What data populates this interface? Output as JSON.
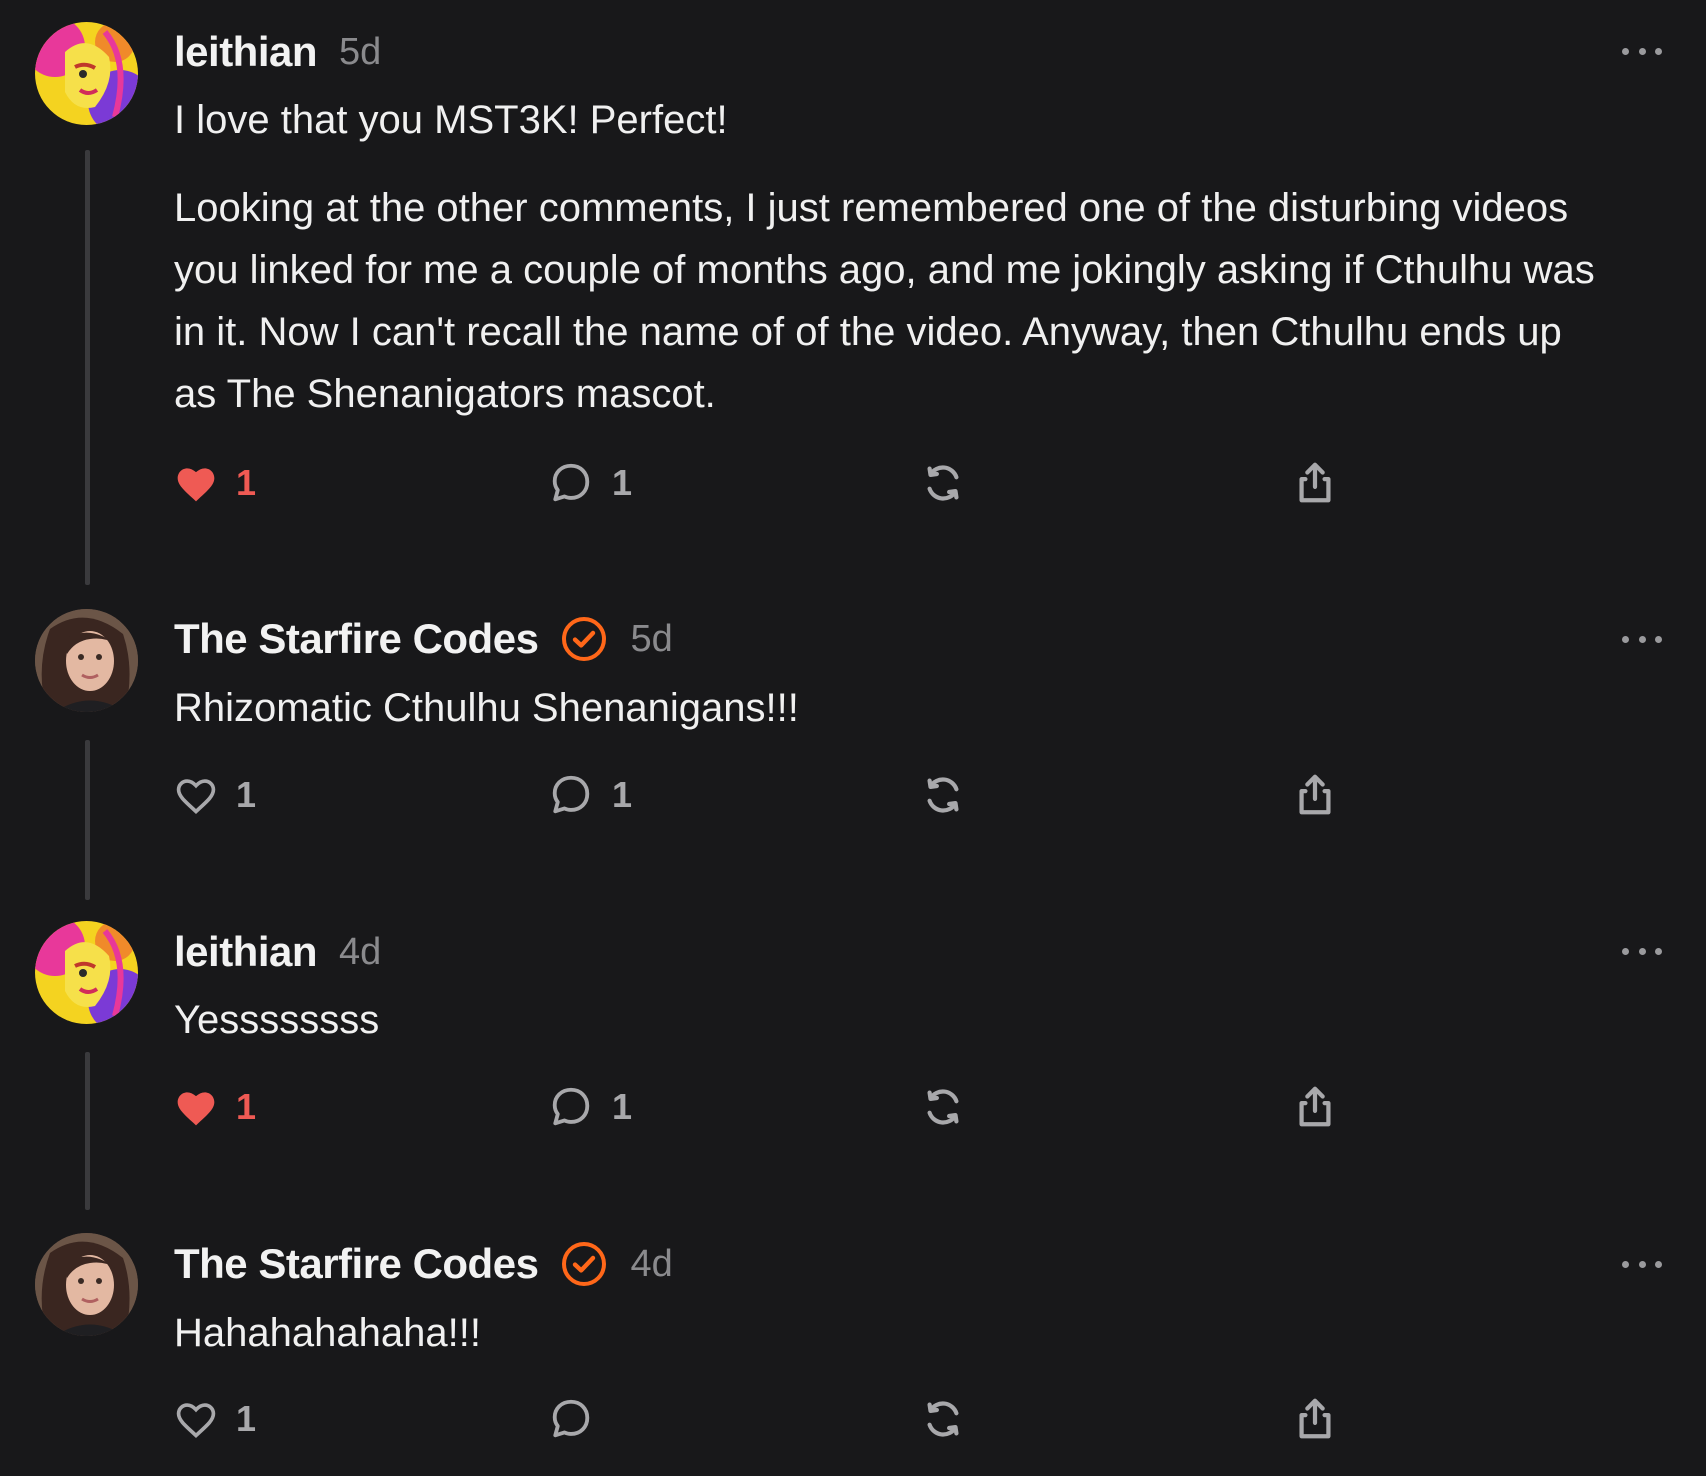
{
  "colors": {
    "background": "#18181a",
    "liked_heart": "#ef5a54",
    "verified_badge": "#ff6719",
    "muted_text": "#8a8a8d"
  },
  "comments": [
    {
      "username": "leithian",
      "verified": false,
      "avatar": "colorful-pop-art-avatar",
      "timestamp": "5d",
      "paragraphs": [
        "I love that you MST3K! Perfect!",
        "Looking at the other comments, I just remembered one of the disturbing videos you linked for me a couple of months ago, and me jokingly asking if Cthulhu was in it. Now I can't recall the name of of the video. Anyway, then Cthulhu ends up as The Shenanigators mascot."
      ],
      "likes": "1",
      "liked": true,
      "replies": "1"
    },
    {
      "username": "The Starfire Codes",
      "verified": true,
      "avatar": "portrait-photo-avatar",
      "timestamp": "5d",
      "paragraphs": [
        "Rhizomatic Cthulhu Shenanigans!!!"
      ],
      "likes": "1",
      "liked": false,
      "replies": "1"
    },
    {
      "username": "leithian",
      "verified": false,
      "avatar": "colorful-pop-art-avatar",
      "timestamp": "4d",
      "paragraphs": [
        "Yessssssss"
      ],
      "likes": "1",
      "liked": true,
      "replies": "1"
    },
    {
      "username": "The Starfire Codes",
      "verified": true,
      "avatar": "portrait-photo-avatar",
      "timestamp": "4d",
      "paragraphs": [
        "Hahahahahaha!!!"
      ],
      "likes": "1",
      "liked": false,
      "replies": ""
    }
  ]
}
